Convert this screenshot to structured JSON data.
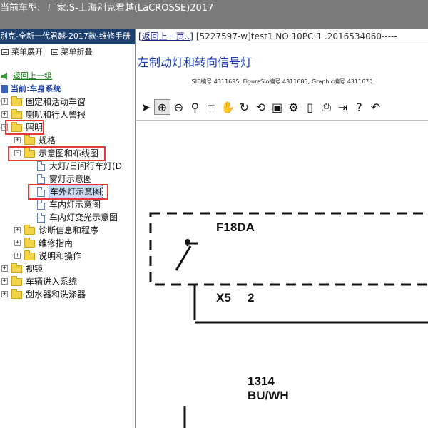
{
  "window": {
    "title_label": "当前车型:",
    "vehicle": "厂家:S-上海别克君越(LaCROSSE)2017"
  },
  "sidebar": {
    "manual_title": "别克-全新一代君越-2017款-维修手册",
    "menu_expand": "菜单展开",
    "menu_collapse": "菜单折叠",
    "back_link": "返回上一级",
    "current_label": "当前:车身系统",
    "tree": [
      {
        "label": "固定和活动车窗",
        "type": "folder",
        "state": "+"
      },
      {
        "label": "喇叭和行人警报",
        "type": "folder",
        "state": "+"
      },
      {
        "label": "照明",
        "type": "folder",
        "state": "-",
        "highlight": true
      },
      {
        "label": "规格",
        "type": "folder",
        "state": "+"
      },
      {
        "label": "示意图和布线图",
        "type": "folder",
        "state": "-",
        "highlight": true
      },
      {
        "label": "大灯/日间行车灯(D",
        "type": "doc"
      },
      {
        "label": "雾灯示意图",
        "type": "doc"
      },
      {
        "label": "车外灯示意图",
        "type": "doc",
        "selected": true,
        "highlight": true
      },
      {
        "label": "车内灯示意图",
        "type": "doc"
      },
      {
        "label": "车内灯变光示意图",
        "type": "doc"
      },
      {
        "label": "诊断信息和程序",
        "type": "folder",
        "state": "+"
      },
      {
        "label": "维修指南",
        "type": "folder",
        "state": "+"
      },
      {
        "label": "说明和操作",
        "type": "folder",
        "state": "+"
      },
      {
        "label": "视镜",
        "type": "folder",
        "state": "+"
      },
      {
        "label": "车辆进入系统",
        "type": "folder",
        "state": "+"
      },
      {
        "label": "刮水器和洗涤器",
        "type": "folder",
        "state": "+"
      }
    ]
  },
  "main": {
    "back_link": "[返回上一页..]",
    "doc_id": "[5227597-w]test1 NO:10PC:1 .2016534060-----",
    "title": "左制动灯和转向信号灯",
    "ids_line": "SIE编号:4311695;  FigureSio编号:4311685;  Graphic编号:4311670",
    "toolbar": [
      {
        "name": "pointer-icon",
        "glyph": "➤"
      },
      {
        "name": "zoom-in-icon",
        "glyph": "⊕",
        "active": true
      },
      {
        "name": "zoom-out-icon",
        "glyph": "⊖"
      },
      {
        "name": "magnifier-icon",
        "glyph": "⚲"
      },
      {
        "name": "crop-icon",
        "glyph": "⌗"
      },
      {
        "name": "pan-hand-icon",
        "glyph": "✋"
      },
      {
        "name": "rotate-icon",
        "glyph": "↻"
      },
      {
        "name": "reset-icon",
        "glyph": "⟲"
      },
      {
        "name": "fit-icon",
        "glyph": "▣"
      },
      {
        "name": "settings-icon",
        "glyph": "⚙"
      },
      {
        "name": "document-icon",
        "glyph": "▯"
      },
      {
        "name": "print-icon",
        "glyph": "⎙"
      },
      {
        "name": "export-icon",
        "glyph": "⇥"
      },
      {
        "name": "help-icon",
        "glyph": "?"
      },
      {
        "name": "undo-icon",
        "glyph": "↶"
      }
    ],
    "diagram": {
      "component": "F18DA",
      "connector": "X5",
      "pin": "2",
      "circuit": "1314",
      "wire_color": "BU/WH"
    }
  }
}
